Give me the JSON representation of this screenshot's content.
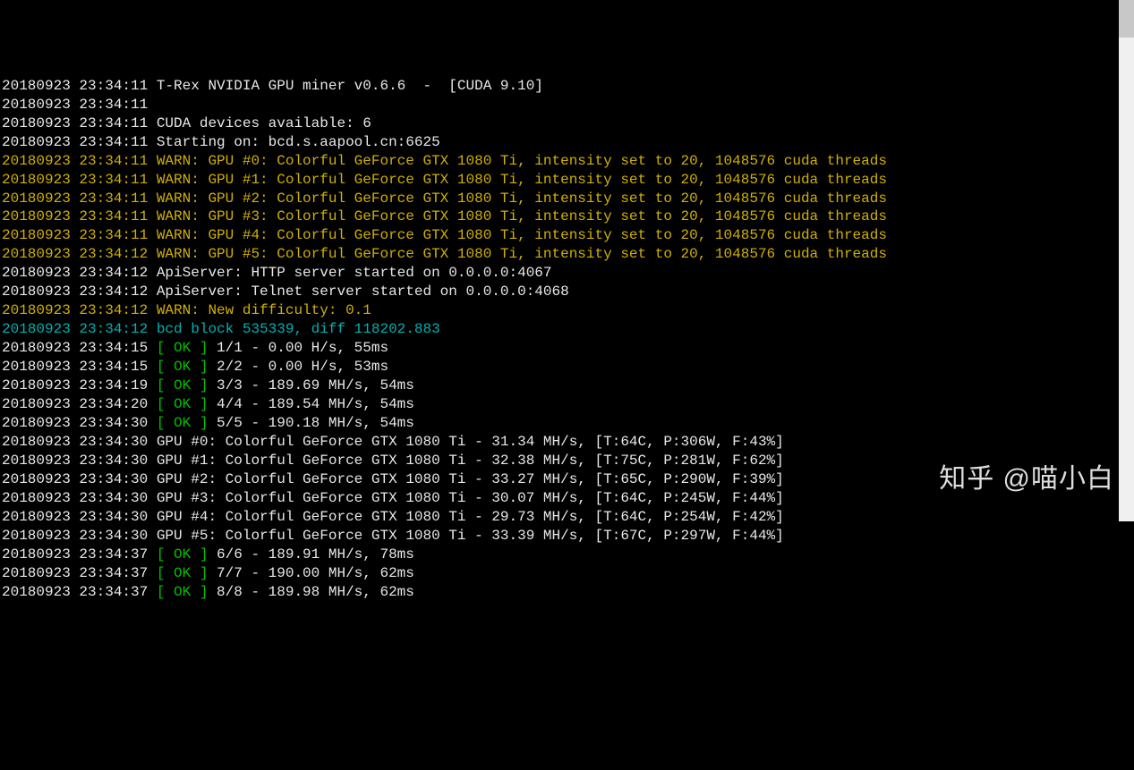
{
  "lines": [
    {
      "type": "white",
      "ts": "20180923 23:34:11",
      "text": "T-Rex NVIDIA GPU miner v0.6.6  -  [CUDA 9.10]"
    },
    {
      "type": "white",
      "ts": "20180923 23:34:11",
      "text": ""
    },
    {
      "type": "white",
      "ts": "20180923 23:34:11",
      "text": "CUDA devices available: 6"
    },
    {
      "type": "white",
      "ts": "20180923 23:34:11",
      "text": "Starting on: bcd.s.aapool.cn:6625"
    },
    {
      "type": "yellow",
      "ts": "20180923 23:34:11",
      "text": "WARN: GPU #0: Colorful GeForce GTX 1080 Ti, intensity set to 20, 1048576 cuda threads"
    },
    {
      "type": "yellow",
      "ts": "20180923 23:34:11",
      "text": "WARN: GPU #1: Colorful GeForce GTX 1080 Ti, intensity set to 20, 1048576 cuda threads"
    },
    {
      "type": "yellow",
      "ts": "20180923 23:34:11",
      "text": "WARN: GPU #2: Colorful GeForce GTX 1080 Ti, intensity set to 20, 1048576 cuda threads"
    },
    {
      "type": "yellow",
      "ts": "20180923 23:34:11",
      "text": "WARN: GPU #3: Colorful GeForce GTX 1080 Ti, intensity set to 20, 1048576 cuda threads"
    },
    {
      "type": "yellow",
      "ts": "20180923 23:34:11",
      "text": "WARN: GPU #4: Colorful GeForce GTX 1080 Ti, intensity set to 20, 1048576 cuda threads"
    },
    {
      "type": "yellow",
      "ts": "20180923 23:34:12",
      "text": "WARN: GPU #5: Colorful GeForce GTX 1080 Ti, intensity set to 20, 1048576 cuda threads"
    },
    {
      "type": "white",
      "ts": "20180923 23:34:12",
      "text": "ApiServer: HTTP server started on 0.0.0.0:4067"
    },
    {
      "type": "white",
      "ts": "20180923 23:34:12",
      "text": "ApiServer: Telnet server started on 0.0.0.0:4068"
    },
    {
      "type": "yellow",
      "ts": "20180923 23:34:12",
      "text": "WARN: New difficulty: 0.1"
    },
    {
      "type": "cyan",
      "ts": "20180923 23:34:12",
      "text": "bcd block 535339, diff 118202.883"
    },
    {
      "type": "ok",
      "ts": "20180923 23:34:15",
      "ok": "[ OK ]",
      "rest": "1/1 - 0.00 H/s, 55ms"
    },
    {
      "type": "ok",
      "ts": "20180923 23:34:15",
      "ok": "[ OK ]",
      "rest": "2/2 - 0.00 H/s, 53ms"
    },
    {
      "type": "ok",
      "ts": "20180923 23:34:19",
      "ok": "[ OK ]",
      "rest": "3/3 - 189.69 MH/s, 54ms"
    },
    {
      "type": "ok",
      "ts": "20180923 23:34:20",
      "ok": "[ OK ]",
      "rest": "4/4 - 189.54 MH/s, 54ms"
    },
    {
      "type": "ok",
      "ts": "20180923 23:34:30",
      "ok": "[ OK ]",
      "rest": "5/5 - 190.18 MH/s, 54ms"
    },
    {
      "type": "white",
      "ts": "20180923 23:34:30",
      "text": "GPU #0: Colorful GeForce GTX 1080 Ti - 31.34 MH/s, [T:64C, P:306W, F:43%]"
    },
    {
      "type": "white",
      "ts": "20180923 23:34:30",
      "text": "GPU #1: Colorful GeForce GTX 1080 Ti - 32.38 MH/s, [T:75C, P:281W, F:62%]"
    },
    {
      "type": "white",
      "ts": "20180923 23:34:30",
      "text": "GPU #2: Colorful GeForce GTX 1080 Ti - 33.27 MH/s, [T:65C, P:290W, F:39%]"
    },
    {
      "type": "white",
      "ts": "20180923 23:34:30",
      "text": "GPU #3: Colorful GeForce GTX 1080 Ti - 30.07 MH/s, [T:64C, P:245W, F:44%]"
    },
    {
      "type": "white",
      "ts": "20180923 23:34:30",
      "text": "GPU #4: Colorful GeForce GTX 1080 Ti - 29.73 MH/s, [T:64C, P:254W, F:42%]"
    },
    {
      "type": "white",
      "ts": "20180923 23:34:30",
      "text": "GPU #5: Colorful GeForce GTX 1080 Ti - 33.39 MH/s, [T:67C, P:297W, F:44%]"
    },
    {
      "type": "ok",
      "ts": "20180923 23:34:37",
      "ok": "[ OK ]",
      "rest": "6/6 - 189.91 MH/s, 78ms"
    },
    {
      "type": "ok",
      "ts": "20180923 23:34:37",
      "ok": "[ OK ]",
      "rest": "7/7 - 190.00 MH/s, 62ms"
    },
    {
      "type": "ok",
      "ts": "20180923 23:34:37",
      "ok": "[ OK ]",
      "rest": "8/8 - 189.98 MH/s, 62ms"
    }
  ],
  "watermark": "知乎 @喵小白"
}
